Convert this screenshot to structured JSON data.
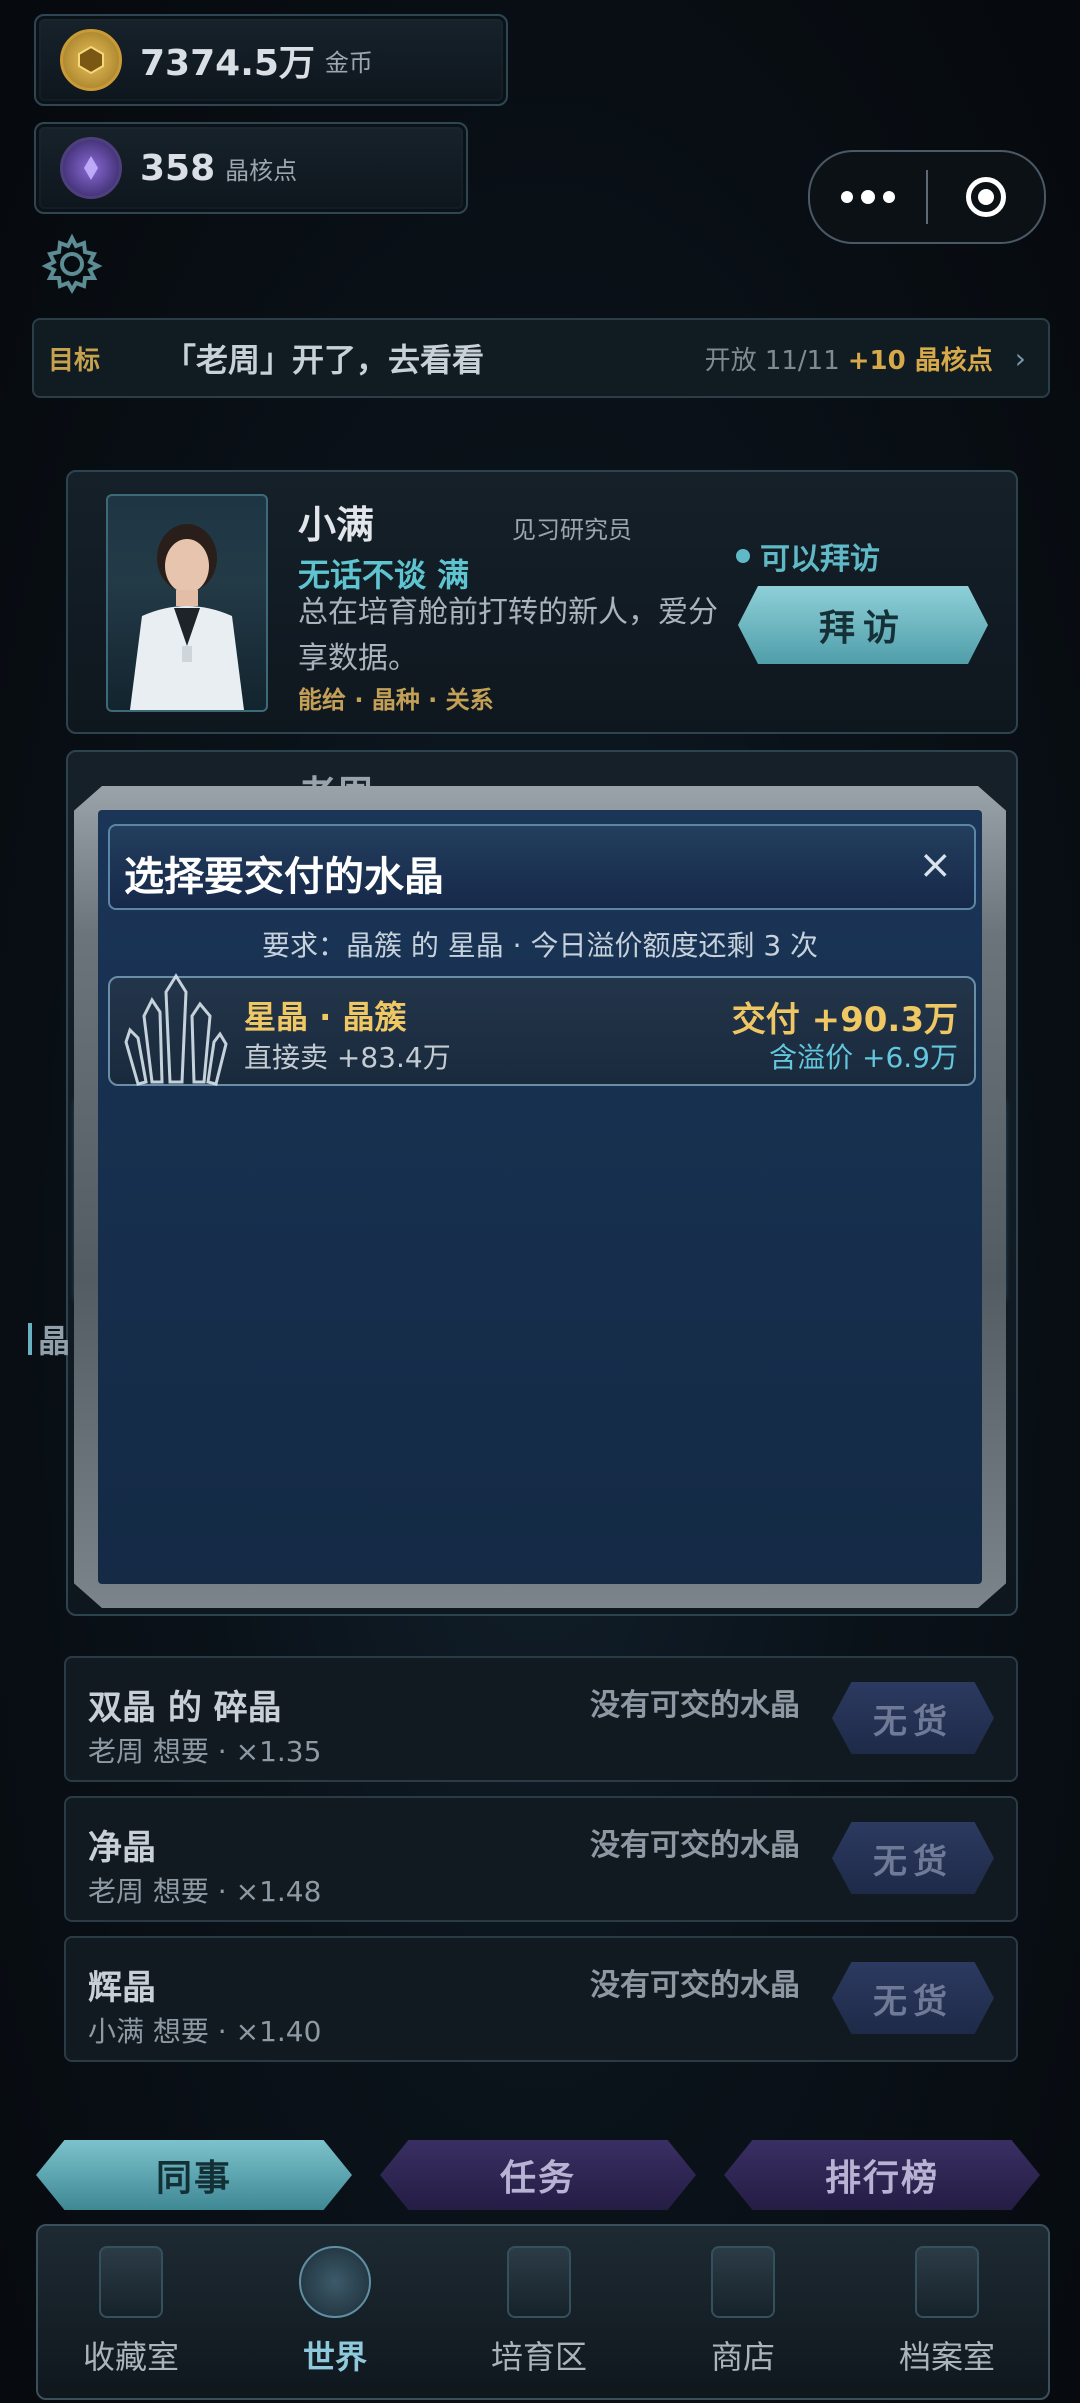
{
  "currency": {
    "gold": {
      "value": "7374.5万",
      "unit": "金币",
      "icon": "gold-coin-icon"
    },
    "core": {
      "value": "358",
      "unit": "晶核点",
      "icon": "crystal-core-icon"
    }
  },
  "capsule": {
    "more_icon": "more-dots-icon",
    "close_icon": "target-close-icon"
  },
  "settings_icon": "gear-icon",
  "target": {
    "label": "目标",
    "text": "「老周」开了，去看看",
    "open": "开放 11/11",
    "reward": "+10 晶核点",
    "chevron": "›"
  },
  "npc_card": {
    "name": "小满",
    "role": "见习研究员",
    "relation": "无话不谈 满",
    "description_line1": "总在培育舱前打转的新人，爱分",
    "description_line2": "享数据。",
    "tags": "能给 · 晶种 · 关系",
    "visit_status": "可以拜访",
    "visit_button": "拜访"
  },
  "second_card_partial_name": "老周",
  "side_label": "晶",
  "modal": {
    "title": "选择要交付的水晶",
    "close": "×",
    "requirement": "要求：晶簇 的 星晶 · 今日溢价额度还剩 3 次",
    "items": [
      {
        "name": "星晶 · 晶簇",
        "direct_sell": "直接卖 +83.4万",
        "deliver": "交付 +90.3万",
        "premium": "含溢价 +6.9万"
      }
    ]
  },
  "orders": [
    {
      "title": "双晶 的 碎晶",
      "sub": "老周 想要 · ×1.35",
      "status": "没有可交的水晶",
      "button": "无货"
    },
    {
      "title": "净晶",
      "sub": "老周 想要 · ×1.48",
      "status": "没有可交的水晶",
      "button": "无货"
    },
    {
      "title": "辉晶",
      "sub": "小满 想要 · ×1.40",
      "status": "没有可交的水晶",
      "button": "无货"
    }
  ],
  "sub_tabs": [
    "同事",
    "任务",
    "排行榜"
  ],
  "nav": [
    {
      "label": "收藏室",
      "icon": "collection-room-icon"
    },
    {
      "label": "世界",
      "icon": "world-icon"
    },
    {
      "label": "培育区",
      "icon": "incubator-icon"
    },
    {
      "label": "商店",
      "icon": "shop-icon"
    },
    {
      "label": "档案室",
      "icon": "archive-icon"
    }
  ],
  "colors": {
    "accent_teal": "#5ec4d0",
    "gold": "#f0c863",
    "modal_bg": "#17304f",
    "inactive_tab": "#2d2554"
  }
}
